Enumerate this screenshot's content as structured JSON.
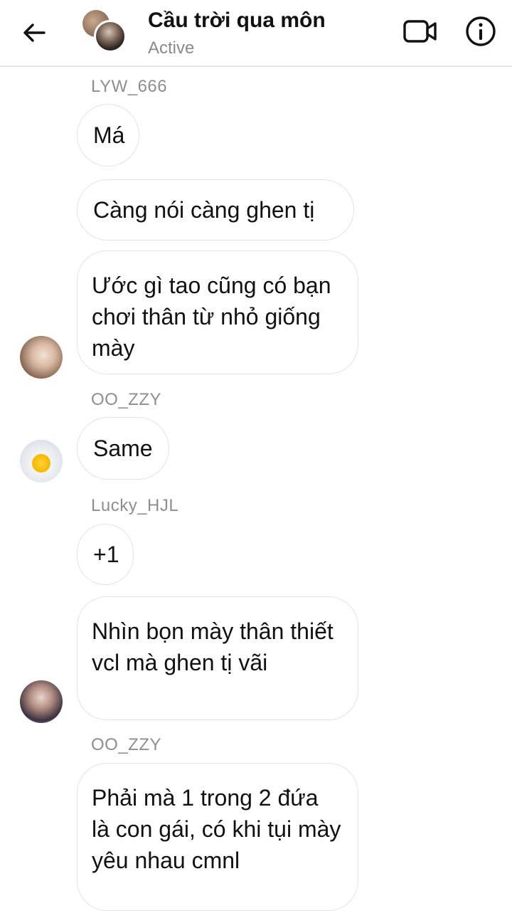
{
  "header": {
    "title": "Cầu trời qua môn",
    "status": "Active",
    "back_icon": "arrow-left-icon",
    "video_icon": "video-camera-icon",
    "info_icon": "info-icon"
  },
  "messages": [
    {
      "sender": "LYW_666",
      "texts": [
        "Má",
        "Càng nói càng ghen tị",
        "Ước gì tao cũng có bạn chơi thân từ nhỏ giống mày"
      ]
    },
    {
      "sender": "OO_ZZY",
      "texts": [
        "Same"
      ]
    },
    {
      "sender": "Lucky_HJL",
      "texts": [
        "+1",
        "Nhìn bọn mày thân thiết vcl mà ghen tị vãi"
      ]
    },
    {
      "sender": "OO_ZZY",
      "texts": [
        "Phải mà 1 trong 2 đứa là con gái, có khi tụi mày yêu nhau cmnl"
      ]
    }
  ],
  "colors": {
    "bubble_border": "#e3e3e3",
    "sender_text": "#8e8e8e",
    "status_text": "#8a8a8a"
  }
}
